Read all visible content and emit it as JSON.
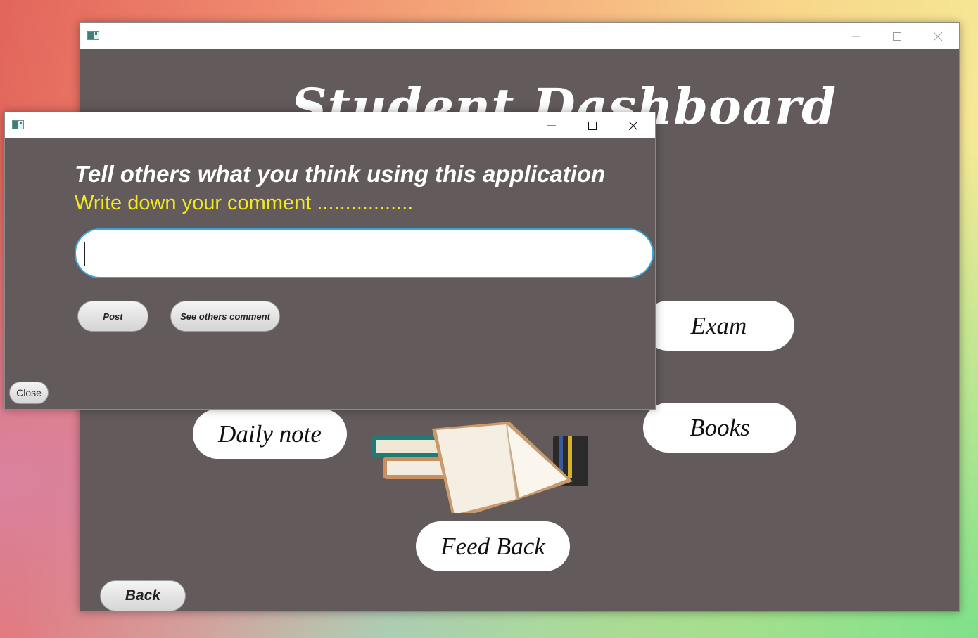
{
  "main_window": {
    "title_text": "Student Dashboard",
    "buttons": {
      "exam": "Exam",
      "books": "Books",
      "daily_note": "Daily note",
      "feedback": "Feed Back",
      "back": "Back"
    },
    "window_controls": [
      "minimize-icon",
      "maximize-icon",
      "close-icon"
    ]
  },
  "dialog": {
    "heading": "Tell others what you think using this application",
    "subheading": "Write down your comment .................",
    "comment_input": {
      "value": "",
      "placeholder": ""
    },
    "post_label": "Post",
    "see_others_label": "See others comment",
    "close_label": "Close",
    "window_controls": [
      "minimize-icon",
      "maximize-icon",
      "close-icon"
    ]
  },
  "colors": {
    "panel_bg": "#625a5b",
    "subheading_yellow": "#f2ea1e",
    "input_focus_border": "#3aa6d8"
  }
}
